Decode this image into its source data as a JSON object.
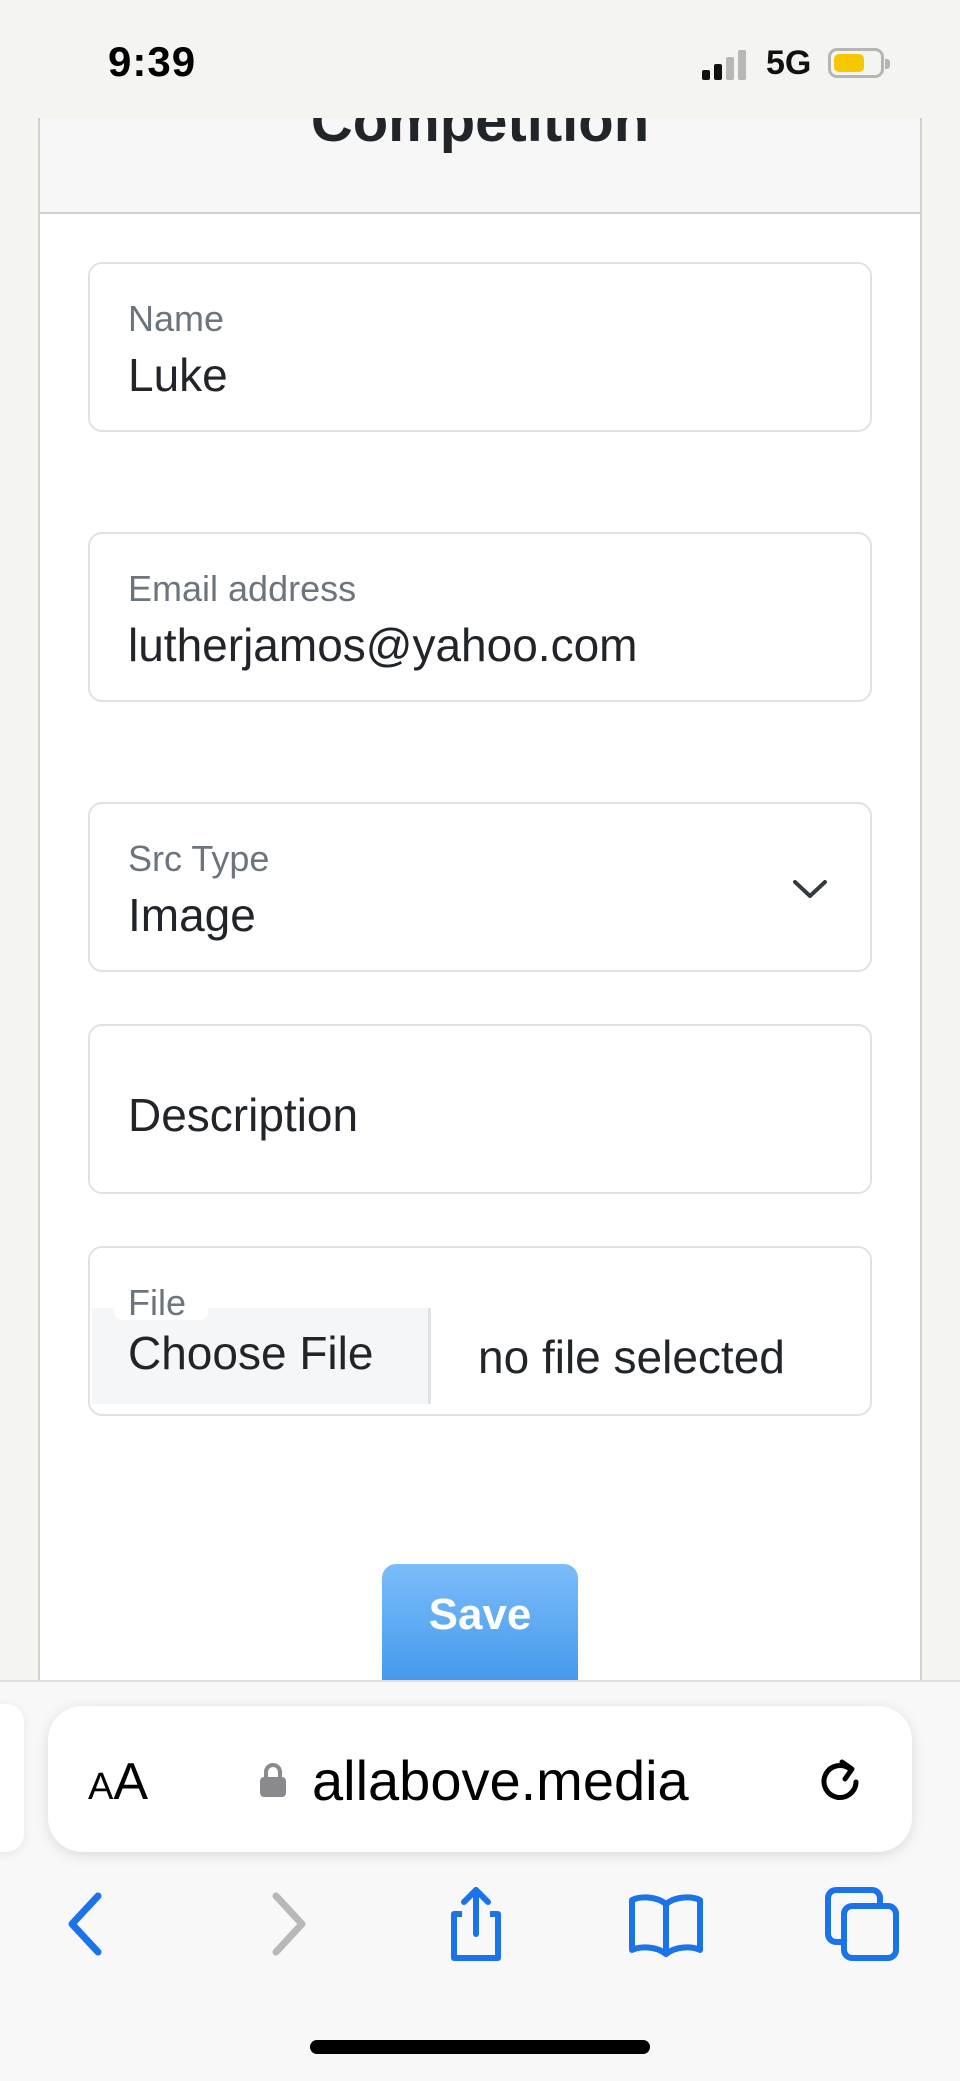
{
  "status_bar": {
    "time": "9:39",
    "network": "5G"
  },
  "page": {
    "title": "Competition"
  },
  "form": {
    "name": {
      "label": "Name",
      "value": "Luke"
    },
    "email": {
      "label": "Email address",
      "value": "lutherjamos@yahoo.com"
    },
    "src_type": {
      "label": "Src Type",
      "value": "Image"
    },
    "description": {
      "placeholder": "Description"
    },
    "file": {
      "label": "File",
      "button_label": "Choose File",
      "status": "no file selected"
    },
    "save_label": "Save"
  },
  "browser": {
    "aa_label": "AA",
    "url": "allabove.media",
    "toolbar_icons": [
      "back-icon",
      "forward-icon",
      "share-icon",
      "bookmarks-icon",
      "tabs-icon"
    ],
    "accent_color": "#1a73e8"
  }
}
